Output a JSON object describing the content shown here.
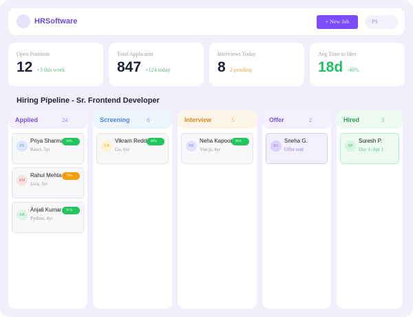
{
  "header": {
    "brand": "HRSoftware",
    "new_job": "+ New Job",
    "user_initials": "PS"
  },
  "stats": [
    {
      "label": "Open Positions",
      "value": "12",
      "sub": "+3 this week",
      "sub_color": "#5cc088"
    },
    {
      "label": "Total Applicants",
      "value": "847",
      "sub": "+124 today",
      "sub_color": "#5cc088"
    },
    {
      "label": "Interviews Today",
      "value": "8",
      "sub": "2 pending",
      "sub_color": "#f0a64a"
    },
    {
      "label": "Avg Time to Hire",
      "value": "18d",
      "sub": "-40%",
      "sub_color": "#5cc088",
      "value_color": "#22c063"
    }
  ],
  "pipeline_title": "Hiring Pipeline - Sr. Frontend Developer",
  "columns": [
    {
      "name": "Applied",
      "count": "24",
      "color": "#7b4fe0",
      "bg": "#f3effd",
      "cards": [
        {
          "initials": "PS",
          "name": "Priya Sharma",
          "detail": "React, 5yr",
          "score": "94%",
          "score_color": "#22c55e",
          "av_bg": "#dce8fd",
          "av_fg": "#6b93e6"
        },
        {
          "initials": "RM",
          "name": "Rahul Mehta",
          "detail": "Java, 3yr",
          "score": "78%",
          "score_color": "#f59e0b",
          "av_bg": "#fde2e2",
          "av_fg": "#e07070"
        },
        {
          "initials": "AK",
          "name": "Anjali Kumar",
          "detail": "Python, 4yr",
          "score": "91%",
          "score_color": "#22c55e",
          "av_bg": "#d9f7e4",
          "av_fg": "#4cb878"
        }
      ]
    },
    {
      "name": "Screening",
      "count": "8",
      "color": "#4a86e8",
      "bg": "#eef4fd",
      "cards": [
        {
          "initials": "VR",
          "name": "Vikram Reddy",
          "detail": "Go, 6yr",
          "score": "88%",
          "score_color": "#22c55e",
          "av_bg": "#fdf3cc",
          "av_fg": "#d6a93a"
        }
      ]
    },
    {
      "name": "Interview",
      "count": "5",
      "color": "#e38a1e",
      "bg": "#fdf5e8",
      "cards": [
        {
          "initials": "NK",
          "name": "Neha Kapoor",
          "detail": "Vue.js, 4yr",
          "score": "86%",
          "score_color": "#22c55e",
          "av_bg": "#e3e6fb",
          "av_fg": "#7a82d8"
        }
      ]
    },
    {
      "name": "Offer",
      "count": "2",
      "color": "#7b4fe0",
      "bg": "#f3effd",
      "cards": [
        {
          "initials": "SG",
          "name": "Sneha G.",
          "detail": "Offer sent",
          "av_bg": "#ddd3fa",
          "av_fg": "#8a6ee0",
          "detail_color": "#9a7fe0"
        }
      ]
    },
    {
      "name": "Hired",
      "count": "3",
      "color": "#2f9e57",
      "bg": "#ecfaf0",
      "cards": [
        {
          "initials": "SP",
          "name": "Suresh P.",
          "detail": "Day 1: Apr 1",
          "av_bg": "#d6f5e0",
          "av_fg": "#4cb878",
          "detail_color": "#5cc088"
        }
      ]
    }
  ]
}
